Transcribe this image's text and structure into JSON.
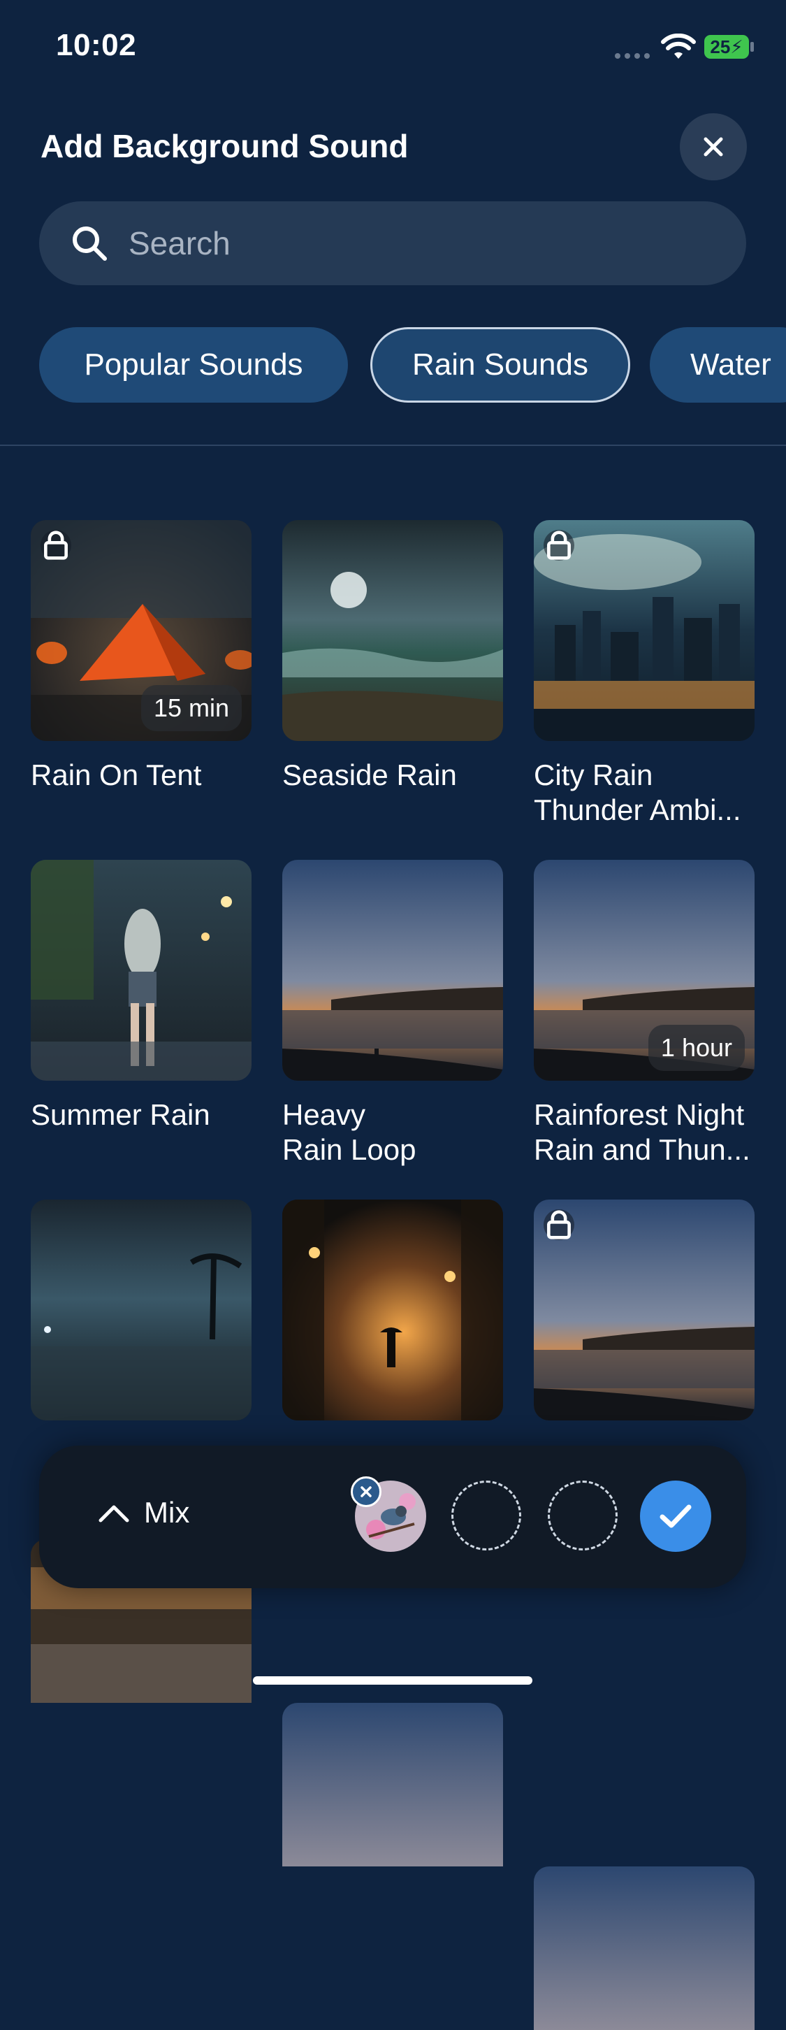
{
  "status_bar": {
    "time": "10:02",
    "battery": "25"
  },
  "header": {
    "title": "Add Background Sound"
  },
  "search": {
    "placeholder": "Search"
  },
  "tabs": [
    {
      "label": "Popular Sounds",
      "selected": false
    },
    {
      "label": "Rain Sounds",
      "selected": true
    },
    {
      "label": "Water",
      "selected": false
    }
  ],
  "sounds": [
    {
      "title": "Rain On Tent",
      "locked": true,
      "duration": "15 min"
    },
    {
      "title": "Seaside Rain",
      "locked": false
    },
    {
      "title": "City Rain\nThunder Ambi...",
      "locked": true
    },
    {
      "title": "Summer Rain",
      "locked": false
    },
    {
      "title": "Heavy\nRain Loop",
      "locked": false
    },
    {
      "title": "Rainforest Night\nRain and Thun...",
      "locked": false,
      "duration": "1 hour"
    },
    {
      "title": "",
      "locked": false
    },
    {
      "title": "",
      "locked": false
    },
    {
      "title": "",
      "locked": true
    }
  ],
  "mix": {
    "label": "Mix"
  },
  "colors": {
    "background": "#0e2340",
    "tab": "#1f4a77",
    "accent": "#3a8ee8",
    "mix_bar": "#111a26"
  },
  "icons": {
    "close": "close-icon",
    "search": "search-icon",
    "lock": "lock-icon",
    "chevron": "chevron-up-icon",
    "check": "check-icon"
  }
}
